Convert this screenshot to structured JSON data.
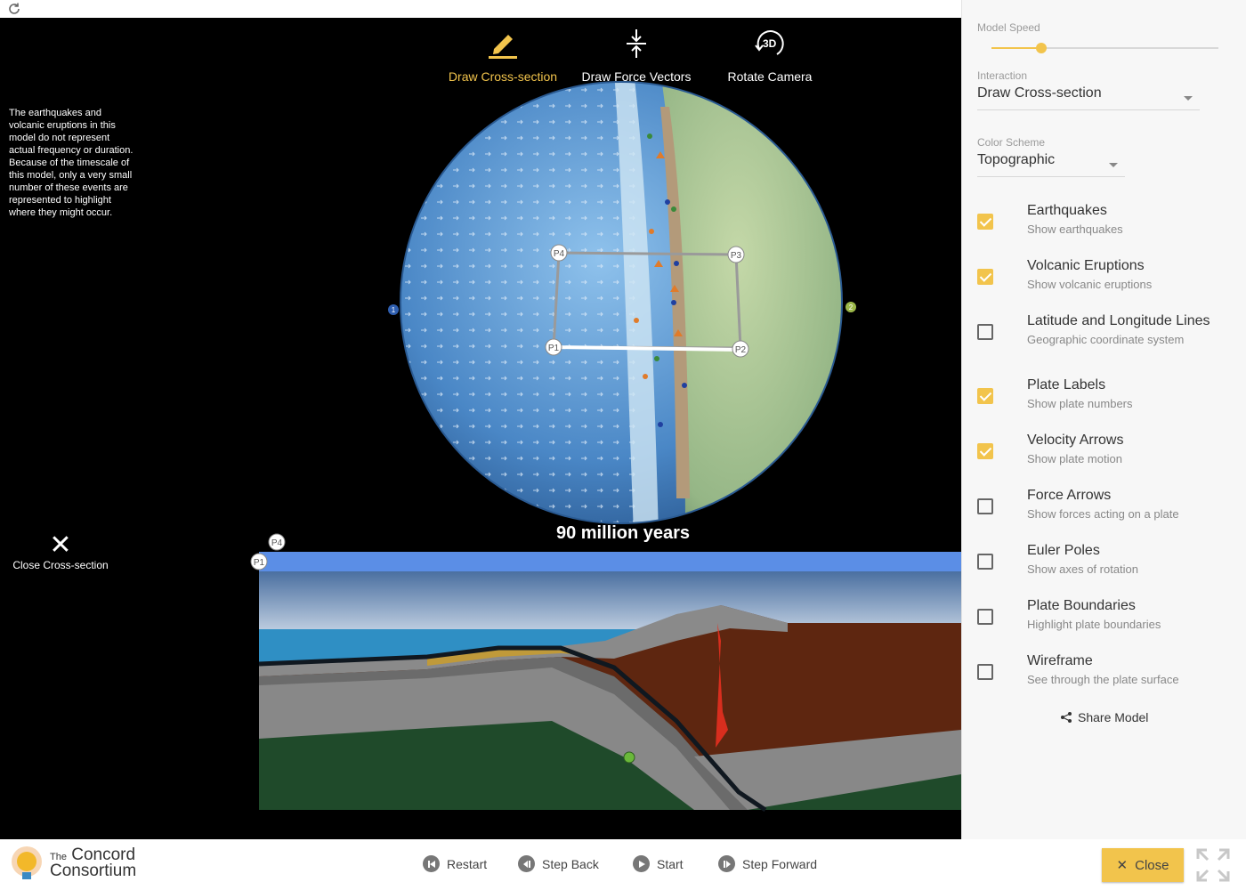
{
  "toolbar": {
    "tools": [
      {
        "label": "Draw Cross-section",
        "icon": "pencil-icon",
        "active": true
      },
      {
        "label": "Draw Force Vectors",
        "icon": "force-vectors-icon",
        "active": false
      },
      {
        "label": "Rotate Camera",
        "icon": "rotate-3d-icon",
        "active": false
      },
      {
        "icon_text": "3D"
      }
    ]
  },
  "note": "The earthquakes and volcanic eruptions in this model do not represent actual frequency or duration. Because of the timescale of this model, only a very small number of these events are represented to highlight where they might occur.",
  "close_cross_section": "Close Cross-section",
  "time_label": "90 million years",
  "globe": {
    "points": [
      "P1",
      "P2",
      "P3",
      "P4"
    ],
    "plate_markers": [
      "1",
      "2"
    ]
  },
  "cross_section": {
    "points": [
      "P1",
      "P4"
    ]
  },
  "panel": {
    "model_speed_label": "Model Speed",
    "model_speed_value": 0.22,
    "interaction_label": "Interaction",
    "interaction_value": "Draw Cross-section",
    "color_scheme_label": "Color Scheme",
    "color_scheme_value": "Topographic",
    "options": [
      {
        "title": "Earthquakes",
        "subtitle": "Show earthquakes",
        "checked": true
      },
      {
        "title": "Volcanic Eruptions",
        "subtitle": "Show volcanic eruptions",
        "checked": true
      },
      {
        "title": "Latitude and Longitude Lines",
        "subtitle": "Geographic coordinate system",
        "checked": false
      },
      {
        "title": "Plate Labels",
        "subtitle": "Show plate numbers",
        "checked": true
      },
      {
        "title": "Velocity Arrows",
        "subtitle": "Show plate motion",
        "checked": true
      },
      {
        "title": "Force Arrows",
        "subtitle": "Show forces acting on a plate",
        "checked": false
      },
      {
        "title": "Euler Poles",
        "subtitle": "Show axes of rotation",
        "checked": false
      },
      {
        "title": "Plate Boundaries",
        "subtitle": "Highlight plate boundaries",
        "checked": false
      },
      {
        "title": "Wireframe",
        "subtitle": "See through the plate surface",
        "checked": false
      }
    ],
    "share_label": "Share Model"
  },
  "footer": {
    "logo_line1": "The",
    "logo_line2": "Concord",
    "logo_line3": "Consortium",
    "restart": "Restart",
    "step_back": "Step Back",
    "start": "Start",
    "step_forward": "Step Forward",
    "close": "Close"
  },
  "colors": {
    "accent": "#f2c44c",
    "ocean": "#4f90d0",
    "land": "#9fbf8e",
    "sky": "#5b8ee6"
  }
}
